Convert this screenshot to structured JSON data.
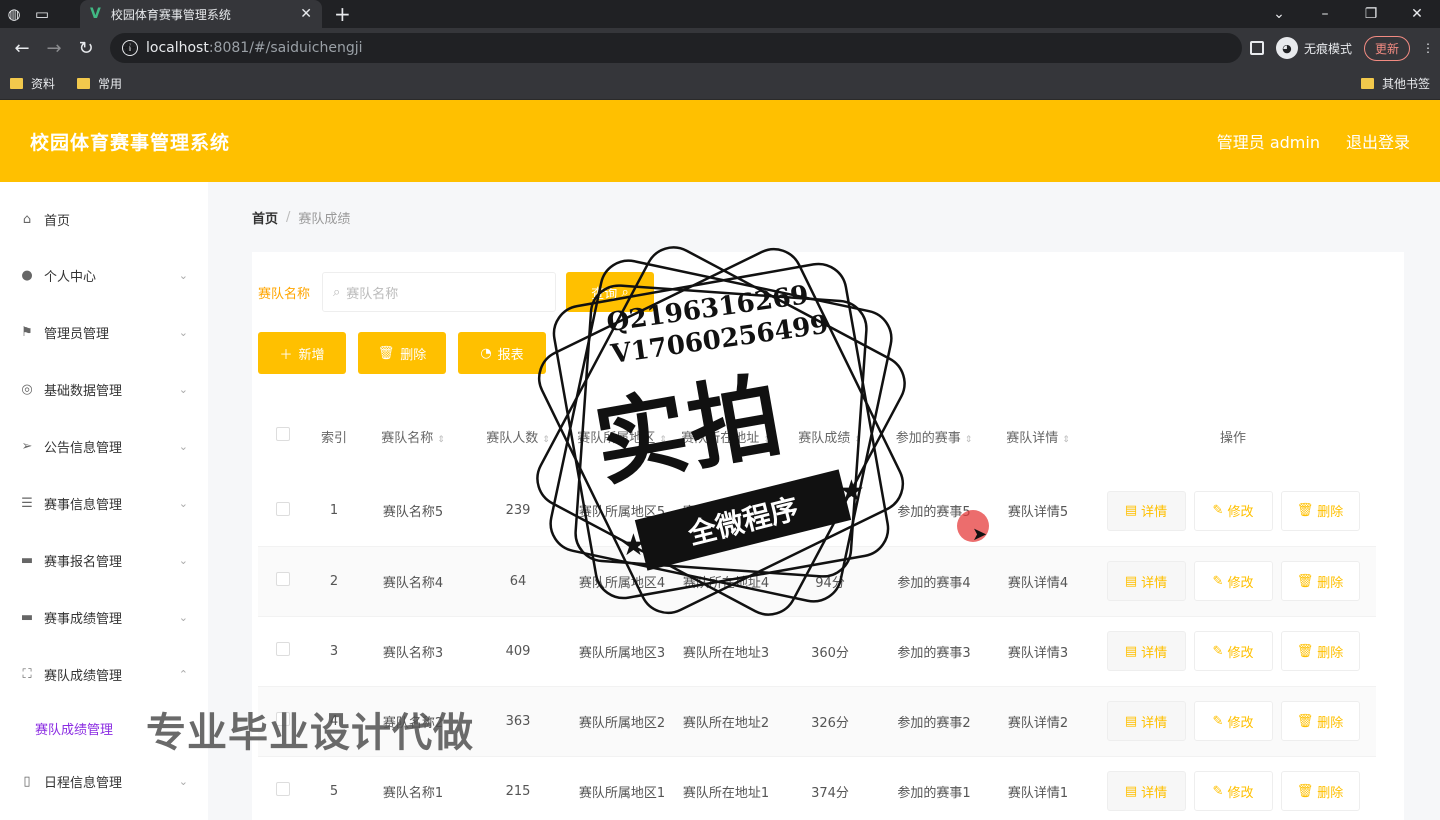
{
  "browser": {
    "tab_title": "校园体育赛事管理系统",
    "url_host": "localhost",
    "url_path": ":8081/#/saiduichengji",
    "incognito_label": "无痕模式",
    "update_label": "更新",
    "bookmarks": [
      "资料",
      "常用"
    ],
    "other_bookmarks": "其他书签"
  },
  "header": {
    "title": "校园体育赛事管理系统",
    "user": "管理员 admin",
    "logout": "退出登录"
  },
  "sidebar": {
    "items": [
      {
        "label": "首页",
        "icon": "home-icon"
      },
      {
        "label": "个人中心",
        "icon": "user-icon"
      },
      {
        "label": "管理员管理",
        "icon": "flag-icon"
      },
      {
        "label": "基础数据管理",
        "icon": "target-icon"
      },
      {
        "label": "公告信息管理",
        "icon": "send-icon"
      },
      {
        "label": "赛事信息管理",
        "icon": "sliders-icon"
      },
      {
        "label": "赛事报名管理",
        "icon": "monitor-icon"
      },
      {
        "label": "赛事成绩管理",
        "icon": "monitor-icon"
      },
      {
        "label": "赛队成绩管理",
        "icon": "crop-icon"
      },
      {
        "label": "日程信息管理",
        "icon": "phone-icon"
      }
    ],
    "active_sub": "赛队成绩管理"
  },
  "breadcrumb": {
    "home": "首页",
    "current": "赛队成绩"
  },
  "search": {
    "label": "赛队名称",
    "placeholder": "赛队名称",
    "button": "查询"
  },
  "actions": {
    "add": "新增",
    "delete": "删除",
    "report": "报表"
  },
  "table": {
    "headers": [
      "索引",
      "赛队名称",
      "赛队人数",
      "赛队所属地区",
      "赛队所在地址",
      "赛队成绩",
      "参加的赛事",
      "赛队详情",
      "操作"
    ],
    "rows": [
      {
        "index": "1",
        "name": "赛队名称5",
        "count": "239",
        "region": "赛队所属地区5",
        "address": "赛队所在地址5",
        "score": "",
        "event": "参加的赛事5",
        "detail": "赛队详情5"
      },
      {
        "index": "2",
        "name": "赛队名称4",
        "count": "64",
        "region": "赛队所属地区4",
        "address": "赛队所在地址4",
        "score": "94分",
        "event": "参加的赛事4",
        "detail": "赛队详情4"
      },
      {
        "index": "3",
        "name": "赛队名称3",
        "count": "409",
        "region": "赛队所属地区3",
        "address": "赛队所在地址3",
        "score": "360分",
        "event": "参加的赛事3",
        "detail": "赛队详情3"
      },
      {
        "index": "4",
        "name": "赛队名称2",
        "count": "363",
        "region": "赛队所属地区2",
        "address": "赛队所在地址2",
        "score": "326分",
        "event": "参加的赛事2",
        "detail": "赛队详情2"
      },
      {
        "index": "5",
        "name": "赛队名称1",
        "count": "215",
        "region": "赛队所属地区1",
        "address": "赛队所在地址1",
        "score": "374分",
        "event": "参加的赛事1",
        "detail": "赛队详情1"
      }
    ],
    "op_labels": {
      "detail": "详情",
      "edit": "修改",
      "delete": "删除"
    }
  },
  "watermark": {
    "qq": "Q2196316269",
    "wx": "V17060256499",
    "big": "实拍",
    "ribbon": "全微程序",
    "bottom": "专业毕业设计代做"
  },
  "colors": {
    "accent": "#ffc000",
    "active_menu": "#8a2be2"
  }
}
